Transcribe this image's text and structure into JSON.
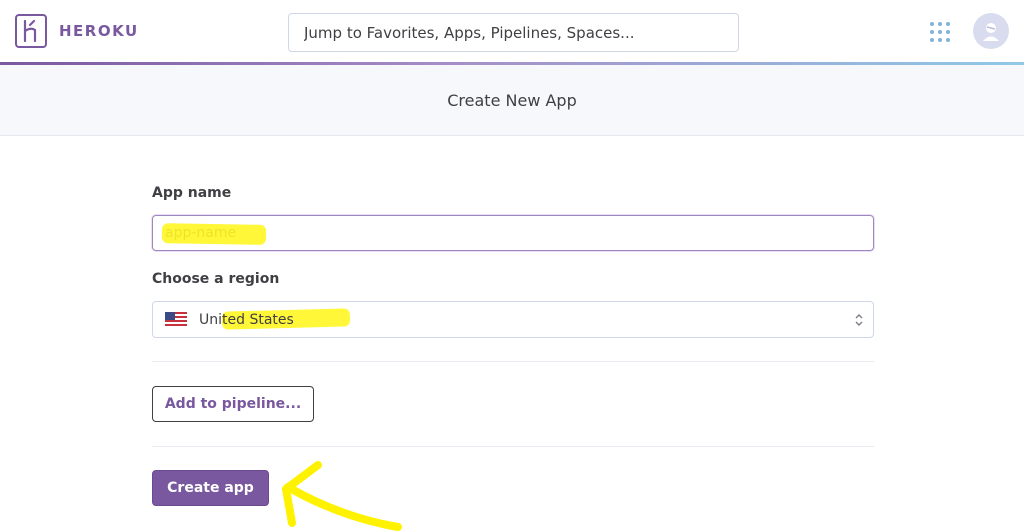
{
  "header": {
    "brand": "HEROKU",
    "search_placeholder": "Jump to Favorites, Apps, Pipelines, Spaces..."
  },
  "page": {
    "title": "Create New App"
  },
  "form": {
    "app_name_label": "App name",
    "app_name_placeholder": "app-name",
    "app_name_value": "",
    "region_label": "Choose a region",
    "region_value": "United States",
    "add_pipeline_label": "Add to pipeline...",
    "create_label": "Create app"
  },
  "colors": {
    "brand": "#79589f",
    "highlight": "#fff500"
  },
  "icons": {
    "logo": "heroku-logo-icon",
    "apps": "apps-grid-icon",
    "avatar": "user-avatar-icon",
    "flag": "us-flag-icon",
    "select": "select-arrows-icon"
  }
}
